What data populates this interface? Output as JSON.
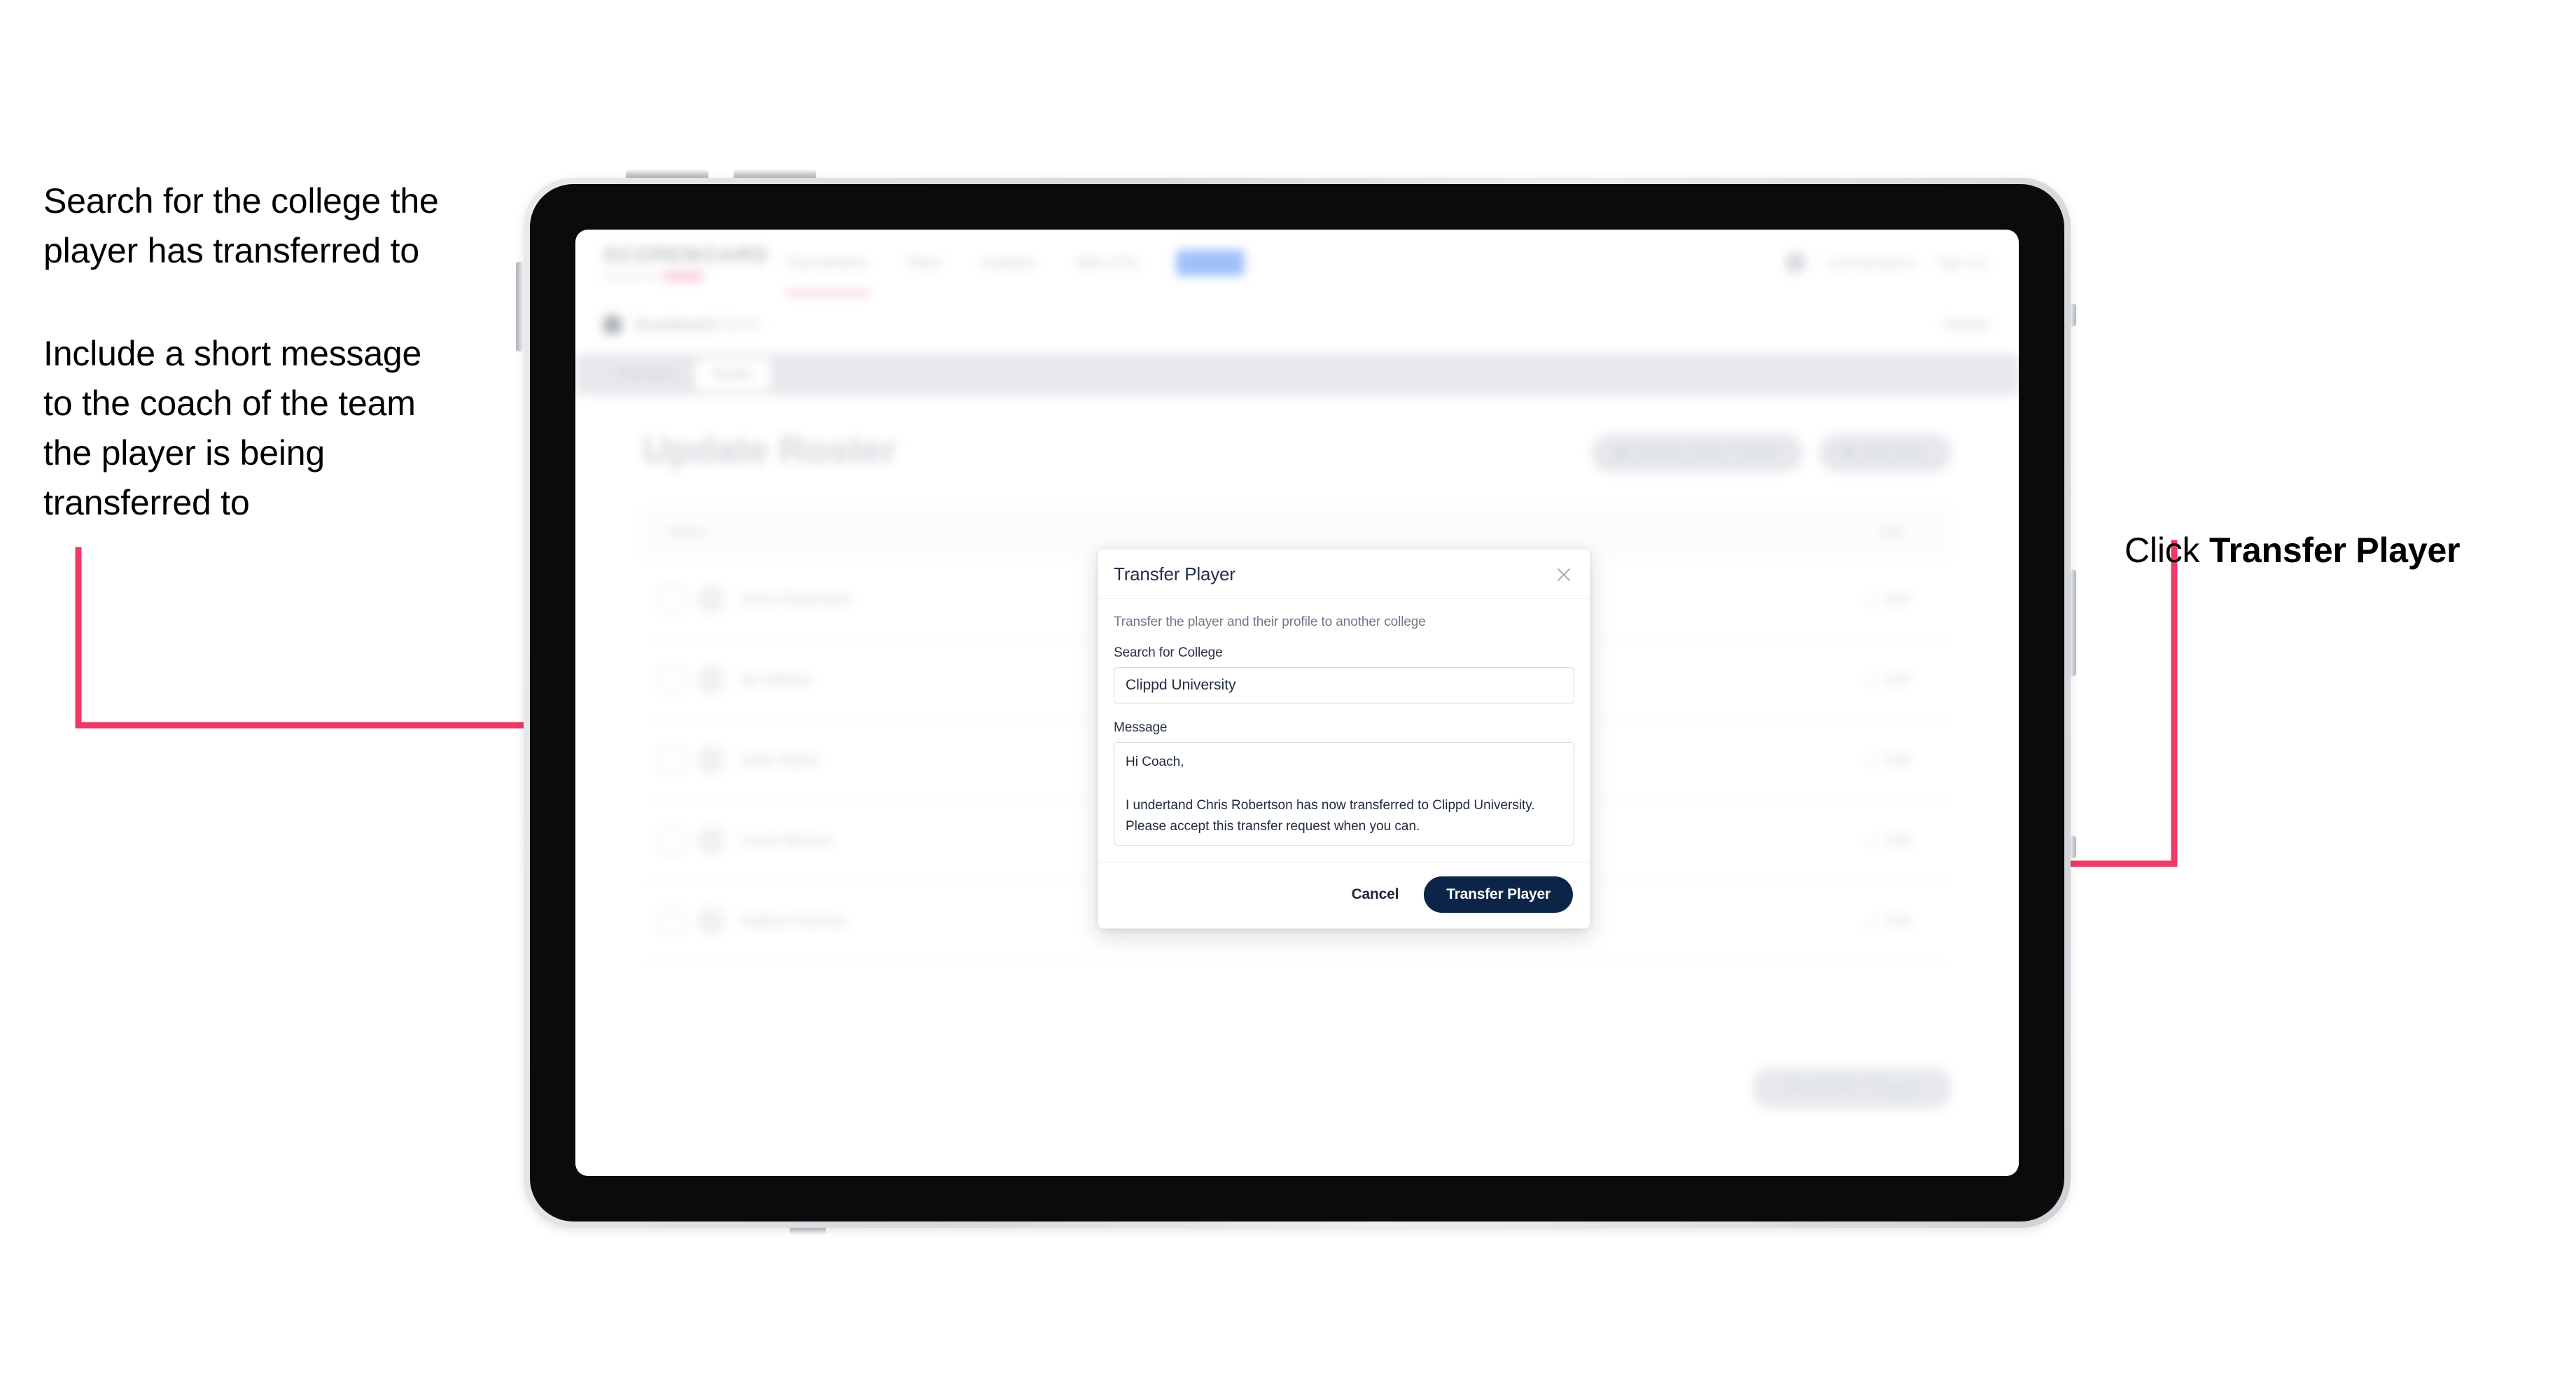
{
  "annotations": {
    "left_top": "Search for the college the\nplayer has transferred to",
    "left_bottom": "Include a short message\nto the coach of the team\nthe player is being\ntransferred to",
    "right_prefix": "Click ",
    "right_strong": "Transfer Player"
  },
  "colors": {
    "arrow_pink": "#EF3A67",
    "primary_navy": "#0B2447",
    "modal_title": "#243049",
    "muted_text": "#6E7789"
  },
  "app": {
    "logo": {
      "main": "SCOREBOARD",
      "sub": "powered by",
      "pill": "clippd"
    },
    "nav_items": [
      {
        "label": "Tournaments"
      },
      {
        "label": "Team"
      },
      {
        "label": "Analytics"
      },
      {
        "label": "Add a Pro"
      },
      {
        "label": "Roster"
      }
    ],
    "account": {
      "email": "coach@clippd.io",
      "sign_out": "Sign Out"
    },
    "breadcrumb": {
      "title": "Scoreboard",
      "subtitle": "Admin"
    },
    "cancel_label": "Cancel",
    "tabs": [
      {
        "label": "Overview",
        "active": false
      },
      {
        "label": "Roster",
        "active": true
      }
    ],
    "page_title": "Update Roster",
    "actions": [
      {
        "label": "Request Player Transfer"
      },
      {
        "label": "Add Player"
      }
    ],
    "table": {
      "columns": [
        "Name",
        "Edit"
      ],
      "rows": [
        {
          "name": "Chris Robertson",
          "edit": "Edit"
        },
        {
          "name": "Ian Wilson",
          "edit": "Edit"
        },
        {
          "name": "John Taylor",
          "edit": "Edit"
        },
        {
          "name": "Lewis Barnes",
          "edit": "Edit"
        },
        {
          "name": "Nathan Holmes",
          "edit": "Edit"
        }
      ]
    },
    "submit_label": "Save Roster Changes"
  },
  "modal": {
    "title": "Transfer Player",
    "close_icon": "close-icon",
    "description": "Transfer the player and their profile to another college",
    "search_label": "Search for College",
    "search_value": "Clippd University",
    "search_placeholder": "Search for College",
    "message_label": "Message",
    "message_value": "Hi Coach,\n\nI undertand Chris Robertson has now transferred to Clippd University. Please accept this transfer request when you can.",
    "message_placeholder": "Message",
    "cancel_label": "Cancel",
    "submit_label": "Transfer Player"
  }
}
